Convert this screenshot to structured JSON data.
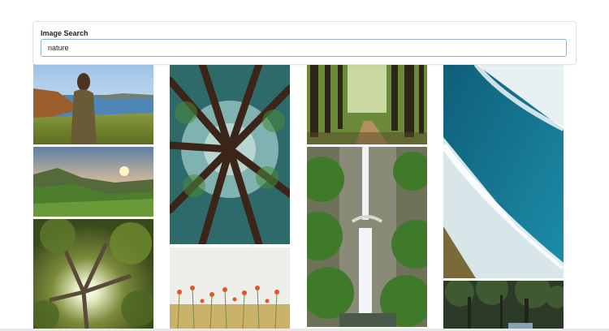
{
  "search": {
    "label": "Image Search",
    "value": "nature"
  },
  "results": [
    {
      "name": "woman-on-coastal-cliff"
    },
    {
      "name": "green-valley-sunset"
    },
    {
      "name": "sunlight-through-tree"
    },
    {
      "name": "redwoods-looking-up"
    },
    {
      "name": "poppy-field"
    },
    {
      "name": "forest-path"
    },
    {
      "name": "waterfall-bridge"
    },
    {
      "name": "ocean-waves-aerial"
    },
    {
      "name": "dark-forest"
    }
  ],
  "colors": {
    "accent_border": "#8fb2d6",
    "card_border": "#dfe3e8"
  }
}
